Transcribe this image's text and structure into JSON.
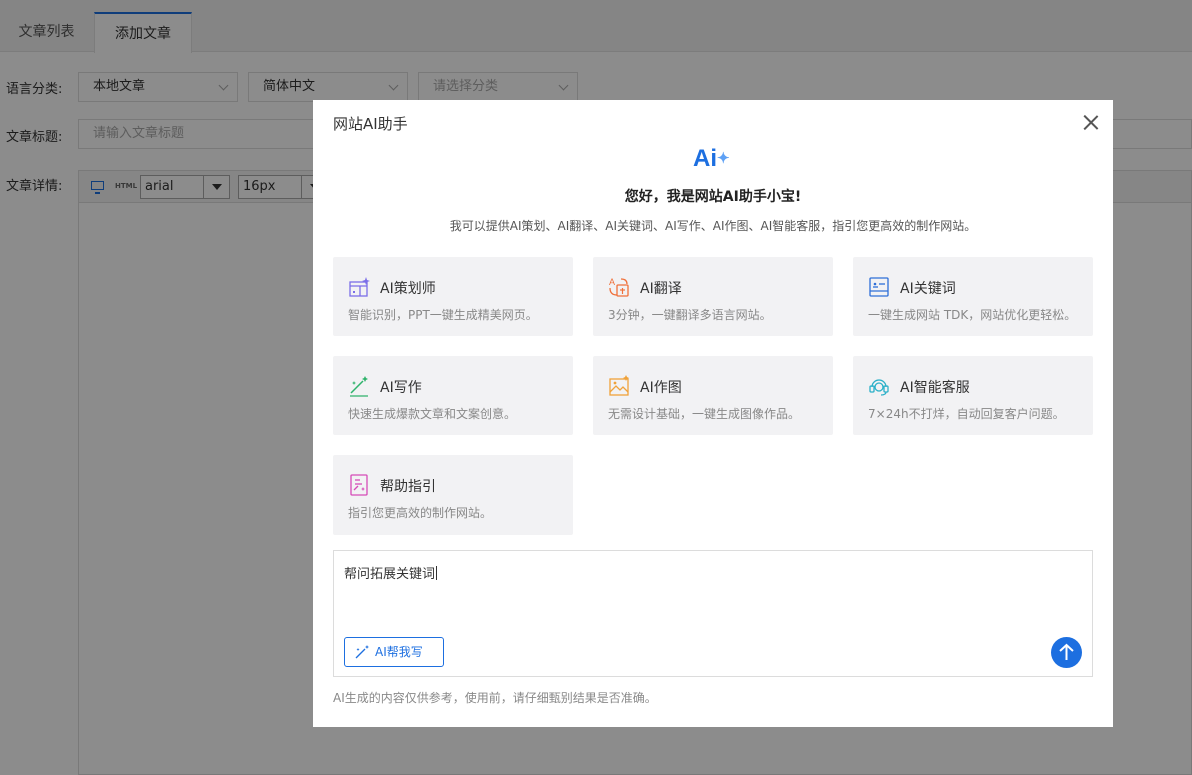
{
  "tabs": [
    "文章列表",
    "添加文章"
  ],
  "form": {
    "lang_label": "语言分类:",
    "lang_select_1": "本地文章",
    "lang_select_2": "简体中文",
    "category_placeholder": "请选择分类",
    "title_label": "文章标题:",
    "title_placeholder": "请输入文章标题",
    "detail_label": "文章详情:"
  },
  "editor": {
    "html_label": "HTML",
    "font": "arial",
    "size": "16px"
  },
  "modal": {
    "title": "网站AI助手",
    "logo_text": "Ai",
    "logo_spark": "✦",
    "greeting": "您好，我是网站AI助手小宝!",
    "intro": "我可以提供AI策划、AI翻译、AI关键词、AI写作、AI作图、AI智能客服，指引您更高效的制作网站。",
    "cards": [
      {
        "title": "AI策划师",
        "desc": "智能识别，PPT一键生成精美网页。",
        "icon": "planner-icon"
      },
      {
        "title": "AI翻译",
        "desc": "3分钟，一键翻译多语言网站。",
        "icon": "translate-icon"
      },
      {
        "title": "AI关键词",
        "desc": "一键生成网站 TDK，网站优化更轻松。",
        "icon": "keyword-icon"
      },
      {
        "title": "AI写作",
        "desc": "快速生成爆款文章和文案创意。",
        "icon": "writing-icon"
      },
      {
        "title": "AI作图",
        "desc": "无需设计基础，一键生成图像作品。",
        "icon": "image-icon"
      },
      {
        "title": "AI智能客服",
        "desc": "7×24h不打烊，自动回复客户问题。",
        "icon": "headset-icon"
      },
      {
        "title": "帮助指引",
        "desc": "指引您更高效的制作网站。",
        "icon": "guide-icon"
      }
    ],
    "chat_value": "帮问拓展关键词",
    "write_button": "AI帮我写",
    "disclaimer": "AI生成的内容仅供参考，使用前，请仔细甄别结果是否准确。"
  },
  "colors": {
    "accent": "#1d6fe0",
    "card_bg": "#f2f2f4"
  }
}
